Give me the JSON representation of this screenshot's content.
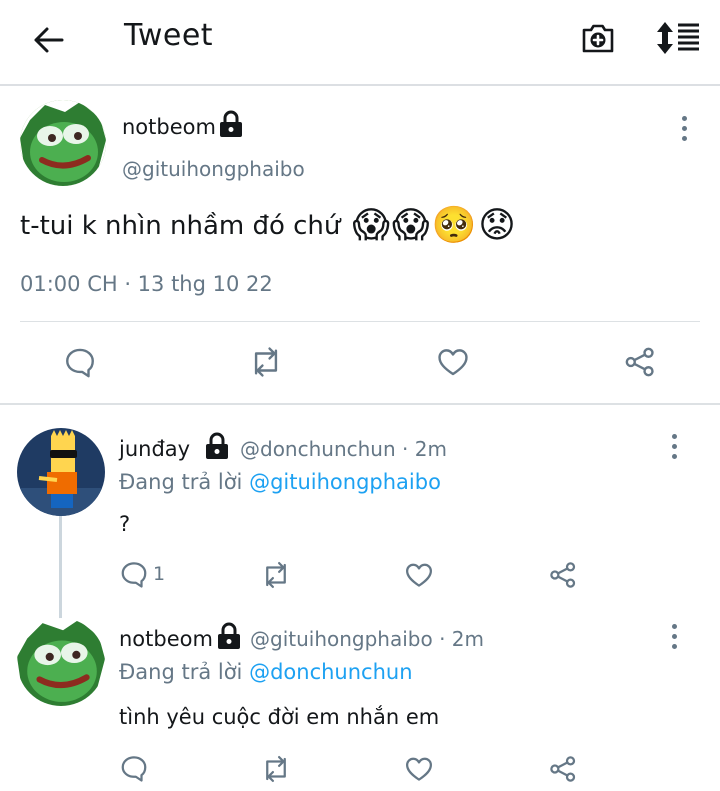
{
  "header": {
    "title": "Tweet",
    "back_icon": "arrow-left-icon",
    "camera_icon": "camera-plus-icon",
    "sort_icon": "sort-list-icon"
  },
  "main_tweet": {
    "name": "notbeom",
    "handle": "@gituihongphaibo",
    "text": "t-tui k nhìn nhầm đó chứ",
    "emojis": [
      "😱",
      "😱",
      "🥺",
      "😟"
    ],
    "timestamp": "01:00 CH · 13 thg 10 22"
  },
  "replies": [
    {
      "name": "junđay",
      "handle": "@donchunchun",
      "time": "· 2m",
      "replying_prefix": "Đang trả lời",
      "replying_to": "@gituihongphaibo",
      "text": "?",
      "reply_count": "1"
    },
    {
      "name": "notbeom",
      "handle": "@gituihongphaibo",
      "time": "· 2m",
      "replying_prefix": "Đang trả lời",
      "replying_to": "@donchunchun",
      "text": "tình yêu cuộc đời em nhắn em",
      "reply_count": ""
    }
  ],
  "colors": {
    "accent": "#1da1f2",
    "muted": "#657786",
    "divider": "#dde1e4"
  }
}
